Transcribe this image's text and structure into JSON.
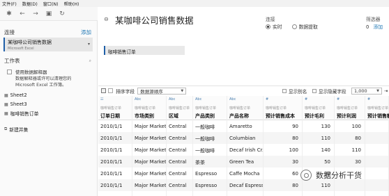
{
  "menu": [
    "文件(F)",
    "数据(D)",
    "窗口(N)",
    "帮助(H)"
  ],
  "toolbar": {
    "icons": [
      "app-logo-icon",
      "back-arrow-icon",
      "forward-arrow-icon",
      "save-icon",
      "refresh-icon"
    ],
    "glyphs": [
      "✱",
      "←",
      "→",
      "▣",
      "↻"
    ]
  },
  "left": {
    "connections_label": "连接",
    "add_label": "添加",
    "connection": {
      "name": "某咖啡公司销售数据",
      "type": "Microsoft Excel"
    },
    "workbook_label": "工作表",
    "interpreter_label": "使用数据解释器",
    "interpreter_desc": "数据解释器或许可以清理您的 Microsoft Excel 工作簿。",
    "sheets": [
      "Sheet2",
      "Sheet3",
      "咖啡销售订单"
    ],
    "new_union": "新建并集"
  },
  "main": {
    "title": "某咖啡公司销售数据",
    "connection_label": "连接",
    "live_label": "实时",
    "extract_label": "数据提取",
    "filter_label": "筛选器",
    "filter_count": "0",
    "filter_add": "添加",
    "canvas_table": "咖啡销售订单"
  },
  "gridbar": {
    "sort_label": "排序字段",
    "sort_value": "数据源顺序",
    "show_alias": "显示别名",
    "show_hidden": "显示隐藏字段",
    "rows_value": "1,000"
  },
  "grid": {
    "columns": [
      {
        "type": "☷",
        "source": "咖啡销售订单",
        "name": "订单日期"
      },
      {
        "type": "Abc",
        "source": "咖啡销售订单",
        "name": "市场类别"
      },
      {
        "type": "Abc",
        "source": "咖啡销售订单",
        "name": "区域"
      },
      {
        "type": "Abc",
        "source": "咖啡销售订单",
        "name": "产品类别"
      },
      {
        "type": "Abc",
        "source": "咖啡销售订单",
        "name": "产品名称"
      },
      {
        "type": "#",
        "source": "咖啡销售订单",
        "name": "预计销售成本"
      },
      {
        "type": "#",
        "source": "咖啡销售订单",
        "name": "预计毛利"
      },
      {
        "type": "#",
        "source": "咖啡销售订单",
        "name": "预计利润"
      },
      {
        "type": "#",
        "source": "咖啡销售订单",
        "name": "预计销售额"
      }
    ],
    "rows": [
      [
        "2010/1/1",
        "Major Market",
        "Central",
        "一般咖啡",
        "Amaretto",
        "90",
        "130",
        "100",
        ""
      ],
      [
        "2010/1/1",
        "Major Market",
        "Central",
        "一般咖啡",
        "Columbian",
        "80",
        "110",
        "80",
        ""
      ],
      [
        "2010/1/1",
        "Major Market",
        "Central",
        "一般咖啡",
        "Decaf Irish Cr...",
        "100",
        "140",
        "110",
        ""
      ],
      [
        "2010/1/1",
        "Major Market",
        "Central",
        "茶茶",
        "Green Tea",
        "30",
        "50",
        "30",
        ""
      ],
      [
        "2010/1/1",
        "Major Market",
        "Central",
        "Espresso",
        "Caffe Mocha",
        "60",
        "90",
        "",
        ""
      ],
      [
        "2010/1/1",
        "Major Market",
        "Central",
        "Espresso",
        "Decaf Espresso",
        "80",
        "110",
        "",
        ""
      ]
    ]
  },
  "watermark": "数据分析干货"
}
